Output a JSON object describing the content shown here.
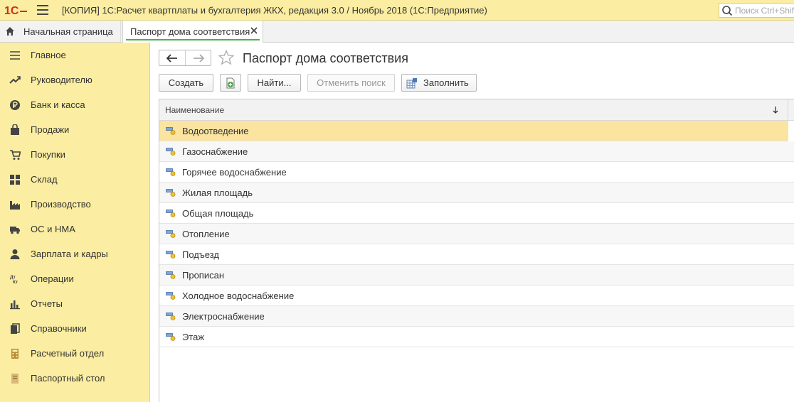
{
  "app": {
    "title": "[КОПИЯ] 1С:Расчет квартплаты и бухгалтерия ЖКХ, редакция 3.0 / Ноябрь 2018  (1С:Предприятие)",
    "search_placeholder": "Поиск Ctrl+Shift+F"
  },
  "tabs": {
    "home_label": "Начальная страница",
    "active_label": "Паспорт дома соответствия"
  },
  "sidebar": {
    "items": [
      {
        "label": "Главное",
        "icon": "menu-lines-icon"
      },
      {
        "label": "Руководителю",
        "icon": "trend-icon"
      },
      {
        "label": "Банк и касса",
        "icon": "ruble-icon"
      },
      {
        "label": "Продажи",
        "icon": "bag-icon"
      },
      {
        "label": "Покупки",
        "icon": "cart-icon"
      },
      {
        "label": "Склад",
        "icon": "warehouse-icon"
      },
      {
        "label": "Производство",
        "icon": "factory-icon"
      },
      {
        "label": "ОС и НМА",
        "icon": "truck-icon"
      },
      {
        "label": "Зарплата и кадры",
        "icon": "person-icon"
      },
      {
        "label": "Операции",
        "icon": "dt-kt-icon"
      },
      {
        "label": "Отчеты",
        "icon": "bar-chart-icon"
      },
      {
        "label": "Справочники",
        "icon": "books-icon"
      },
      {
        "label": "Расчетный отдел",
        "icon": "calculator-icon"
      },
      {
        "label": "Паспортный стол",
        "icon": "folder-icon"
      }
    ]
  },
  "main": {
    "title": "Паспорт дома соответствия",
    "toolbar": {
      "create_label": "Создать",
      "find_label": "Найти...",
      "cancel_search_label": "Отменить поиск",
      "fill_label": "Заполнить"
    },
    "table": {
      "column_header": "Наименование",
      "rows": [
        "Водоотведение",
        "Газоснабжение",
        "Горячее водоснабжение",
        "Жилая площадь",
        "Общая площадь",
        "Отопление",
        "Подъезд",
        "Прописан",
        "Холодное водоснабжение",
        "Электроснабжение",
        "Этаж"
      ],
      "selected_index": 0
    }
  },
  "colors": {
    "panel_yellow": "#fbeda1",
    "selected_row": "#fbe3a0",
    "active_tab_underline": "#4caf50",
    "logo_red": "#d52b1e"
  }
}
